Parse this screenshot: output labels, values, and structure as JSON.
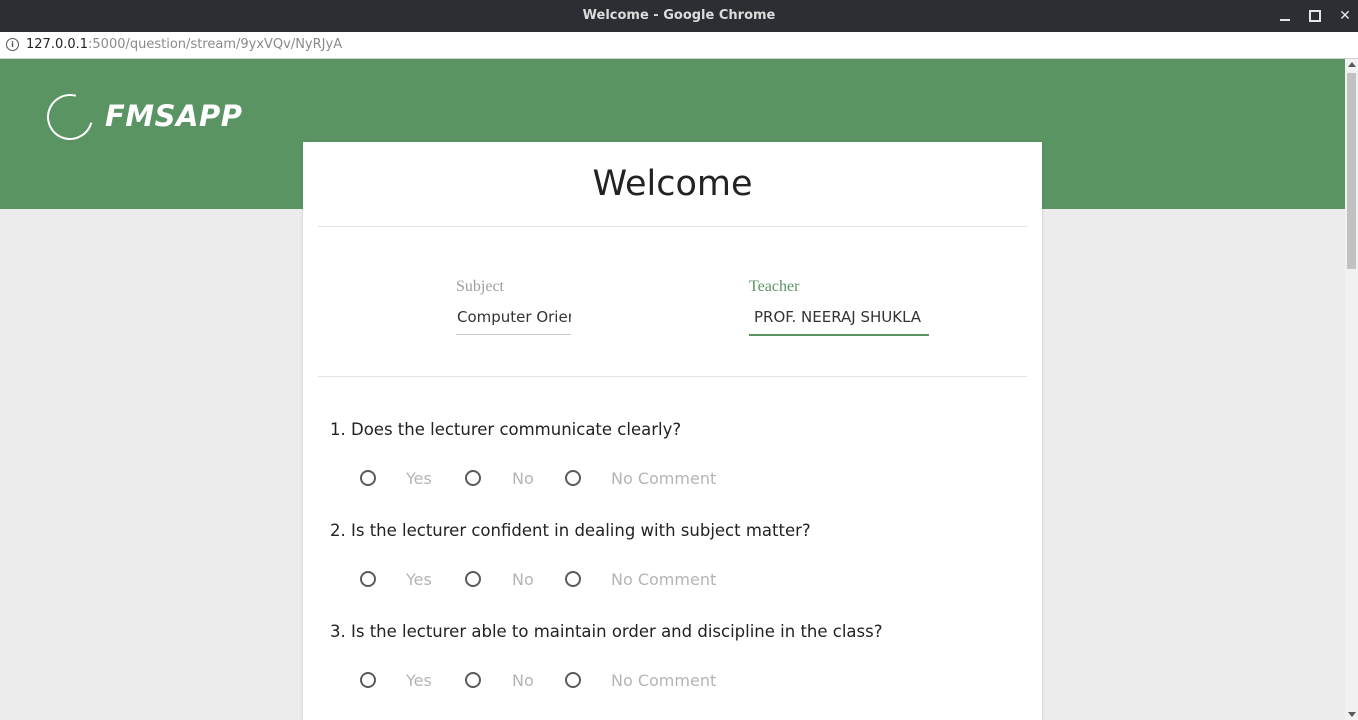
{
  "window": {
    "title": "Welcome - Google Chrome"
  },
  "address_bar": {
    "host": "127.0.0.1",
    "rest": ":5000/question/stream/9yxVQv/NyRJyA"
  },
  "brand": {
    "logo_text": "FMSAPP",
    "color": "#5b9463"
  },
  "card": {
    "title": "Welcome",
    "subject": {
      "label": "Subject",
      "value": "Computer Orien"
    },
    "teacher": {
      "label": "Teacher",
      "value": "PROF. NEERAJ SHUKLA"
    }
  },
  "questions": [
    {
      "text": "1. Does the lecturer communicate clearly?",
      "options": [
        "Yes",
        "No",
        "No Comment"
      ]
    },
    {
      "text": "2. Is the lecturer confident in dealing with subject matter?",
      "options": [
        "Yes",
        "No",
        "No Comment"
      ]
    },
    {
      "text": "3. Is the lecturer able to maintain order and discipline in the class?",
      "options": [
        "Yes",
        "No",
        "No Comment"
      ]
    }
  ]
}
